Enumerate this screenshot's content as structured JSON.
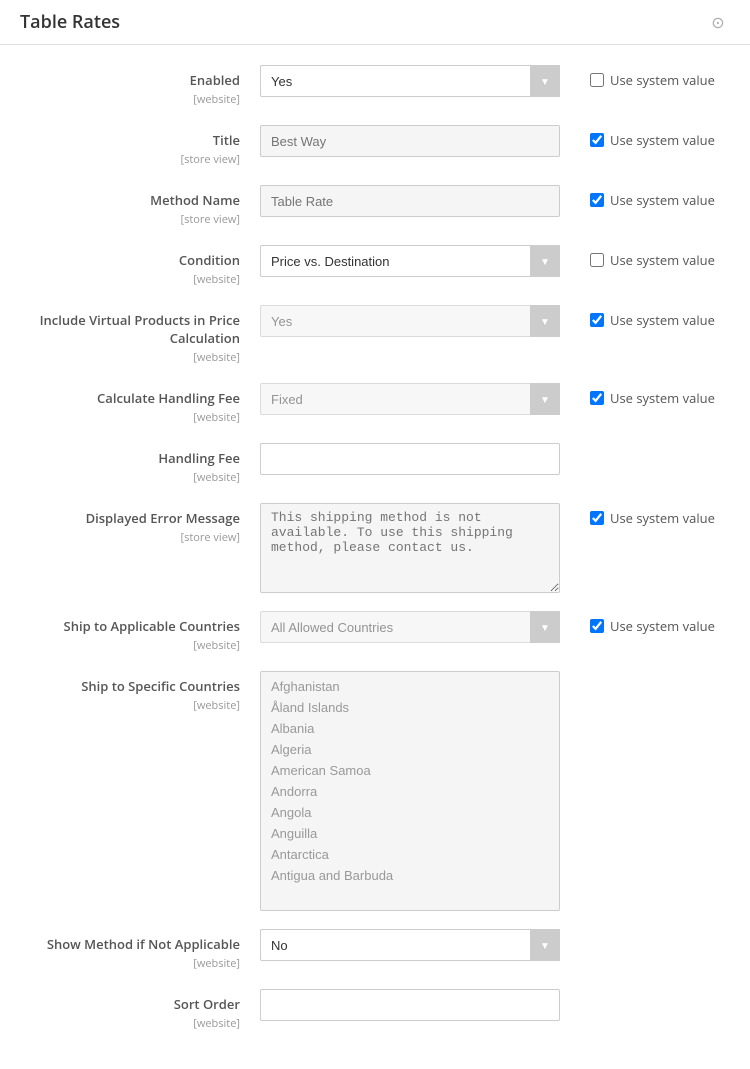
{
  "header": {
    "title": "Table Rates",
    "collapse_icon": "⊙"
  },
  "fields": {
    "enabled": {
      "label": "Enabled",
      "sublabel": "[website]",
      "value": "Yes",
      "use_system": false
    },
    "title": {
      "label": "Title",
      "sublabel": "[store view]",
      "placeholder": "Best Way",
      "use_system": true
    },
    "method_name": {
      "label": "Method Name",
      "sublabel": "[store view]",
      "placeholder": "Table Rate",
      "use_system": true
    },
    "condition": {
      "label": "Condition",
      "sublabel": "[website]",
      "value": "Price vs. Destination",
      "use_system": false
    },
    "include_virtual": {
      "label": "Include Virtual Products in Price Calculation",
      "sublabel": "[website]",
      "value": "Yes",
      "use_system": true
    },
    "calculate_handling": {
      "label": "Calculate Handling Fee",
      "sublabel": "[website]",
      "value": "Fixed",
      "use_system": true
    },
    "handling_fee": {
      "label": "Handling Fee",
      "sublabel": "[website]",
      "value": ""
    },
    "error_message": {
      "label": "Displayed Error Message",
      "sublabel": "[store view]",
      "placeholder": "This shipping method is not available. To use this shipping method, please contact us.",
      "use_system": true
    },
    "ship_applicable": {
      "label": "Ship to Applicable Countries",
      "sublabel": "[website]",
      "value": "All Allowed Countries",
      "use_system": true
    },
    "ship_specific": {
      "label": "Ship to Specific Countries",
      "sublabel": "[website]",
      "countries": [
        "Afghanistan",
        "Åland Islands",
        "Albania",
        "Algeria",
        "American Samoa",
        "Andorra",
        "Angola",
        "Anguilla",
        "Antarctica",
        "Antigua and Barbuda"
      ]
    },
    "show_method": {
      "label": "Show Method if Not Applicable",
      "sublabel": "[website]",
      "value": "No"
    },
    "sort_order": {
      "label": "Sort Order",
      "sublabel": "[website]",
      "value": ""
    }
  },
  "system_value_label": "Use system value"
}
